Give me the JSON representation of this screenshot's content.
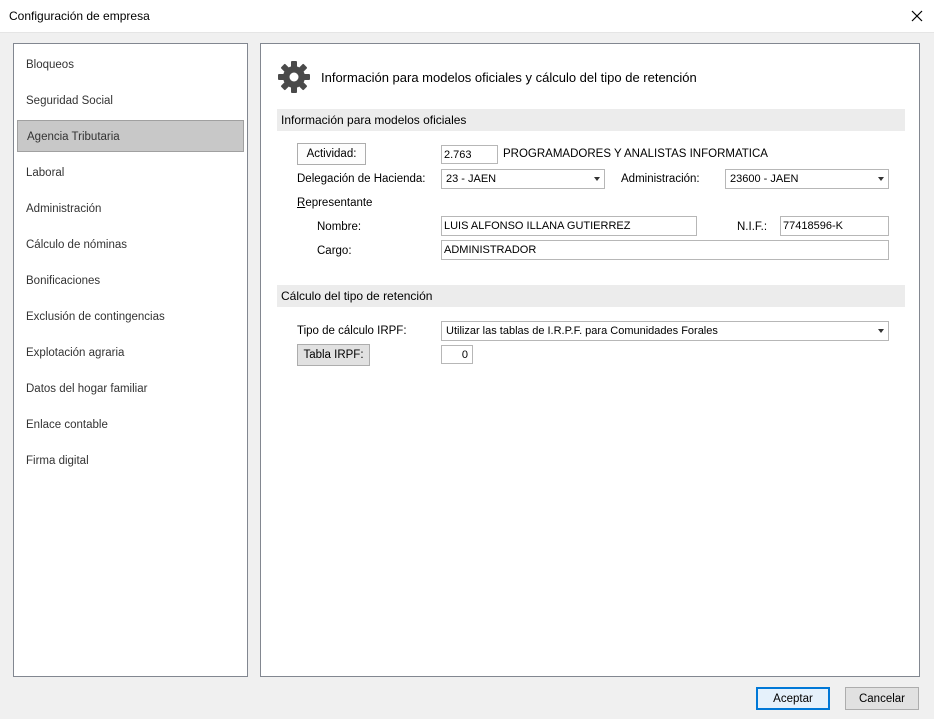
{
  "window": {
    "title": "Configuración de empresa"
  },
  "sidebar": {
    "items": [
      {
        "label": "Bloqueos",
        "selected": false
      },
      {
        "label": "Seguridad Social",
        "selected": false
      },
      {
        "label": "Agencia Tributaria",
        "selected": true
      },
      {
        "label": "Laboral",
        "selected": false
      },
      {
        "label": "Administración",
        "selected": false
      },
      {
        "label": "Cálculo de nóminas",
        "selected": false
      },
      {
        "label": "Bonificaciones",
        "selected": false
      },
      {
        "label": "Exclusión de contingencias",
        "selected": false
      },
      {
        "label": "Explotación agraria",
        "selected": false
      },
      {
        "label": "Datos del hogar familiar",
        "selected": false
      },
      {
        "label": "Enlace contable",
        "selected": false
      },
      {
        "label": "Firma digital",
        "selected": false
      }
    ]
  },
  "main": {
    "title": "Información para modelos oficiales y cálculo del tipo de retención",
    "icon": "gear-icon",
    "section1": {
      "header": "Información para modelos oficiales",
      "actividad_button": "Actividad:",
      "actividad_code": "2.763",
      "actividad_desc": "PROGRAMADORES Y ANALISTAS INFORMATICA",
      "delegacion_label": "Delegación de Hacienda:",
      "delegacion_value": "23 - JAEN",
      "administracion_label": "Administración:",
      "administracion_value": "23600 - JAEN",
      "representante_label": "Representante",
      "nombre_label": "Nombre:",
      "nombre_value": "LUIS ALFONSO ILLANA GUTIERREZ",
      "nif_label": "N.I.F.:",
      "nif_value": "77418596-K",
      "cargo_label": "Cargo:",
      "cargo_value": "ADMINISTRADOR"
    },
    "section2": {
      "header": "Cálculo del tipo de retención",
      "tipo_label": "Tipo de cálculo IRPF:",
      "tipo_value": "Utilizar las tablas de I.R.P.F. para Comunidades Forales",
      "tabla_button": "Tabla IRPF:",
      "tabla_value": "0"
    }
  },
  "footer": {
    "accept_label": "Aceptar",
    "cancel_label": "Cancelar"
  },
  "colors": {
    "selected_nav": "#c8c8c8",
    "section_header": "#ececec",
    "default_button_border": "#0078d7"
  }
}
